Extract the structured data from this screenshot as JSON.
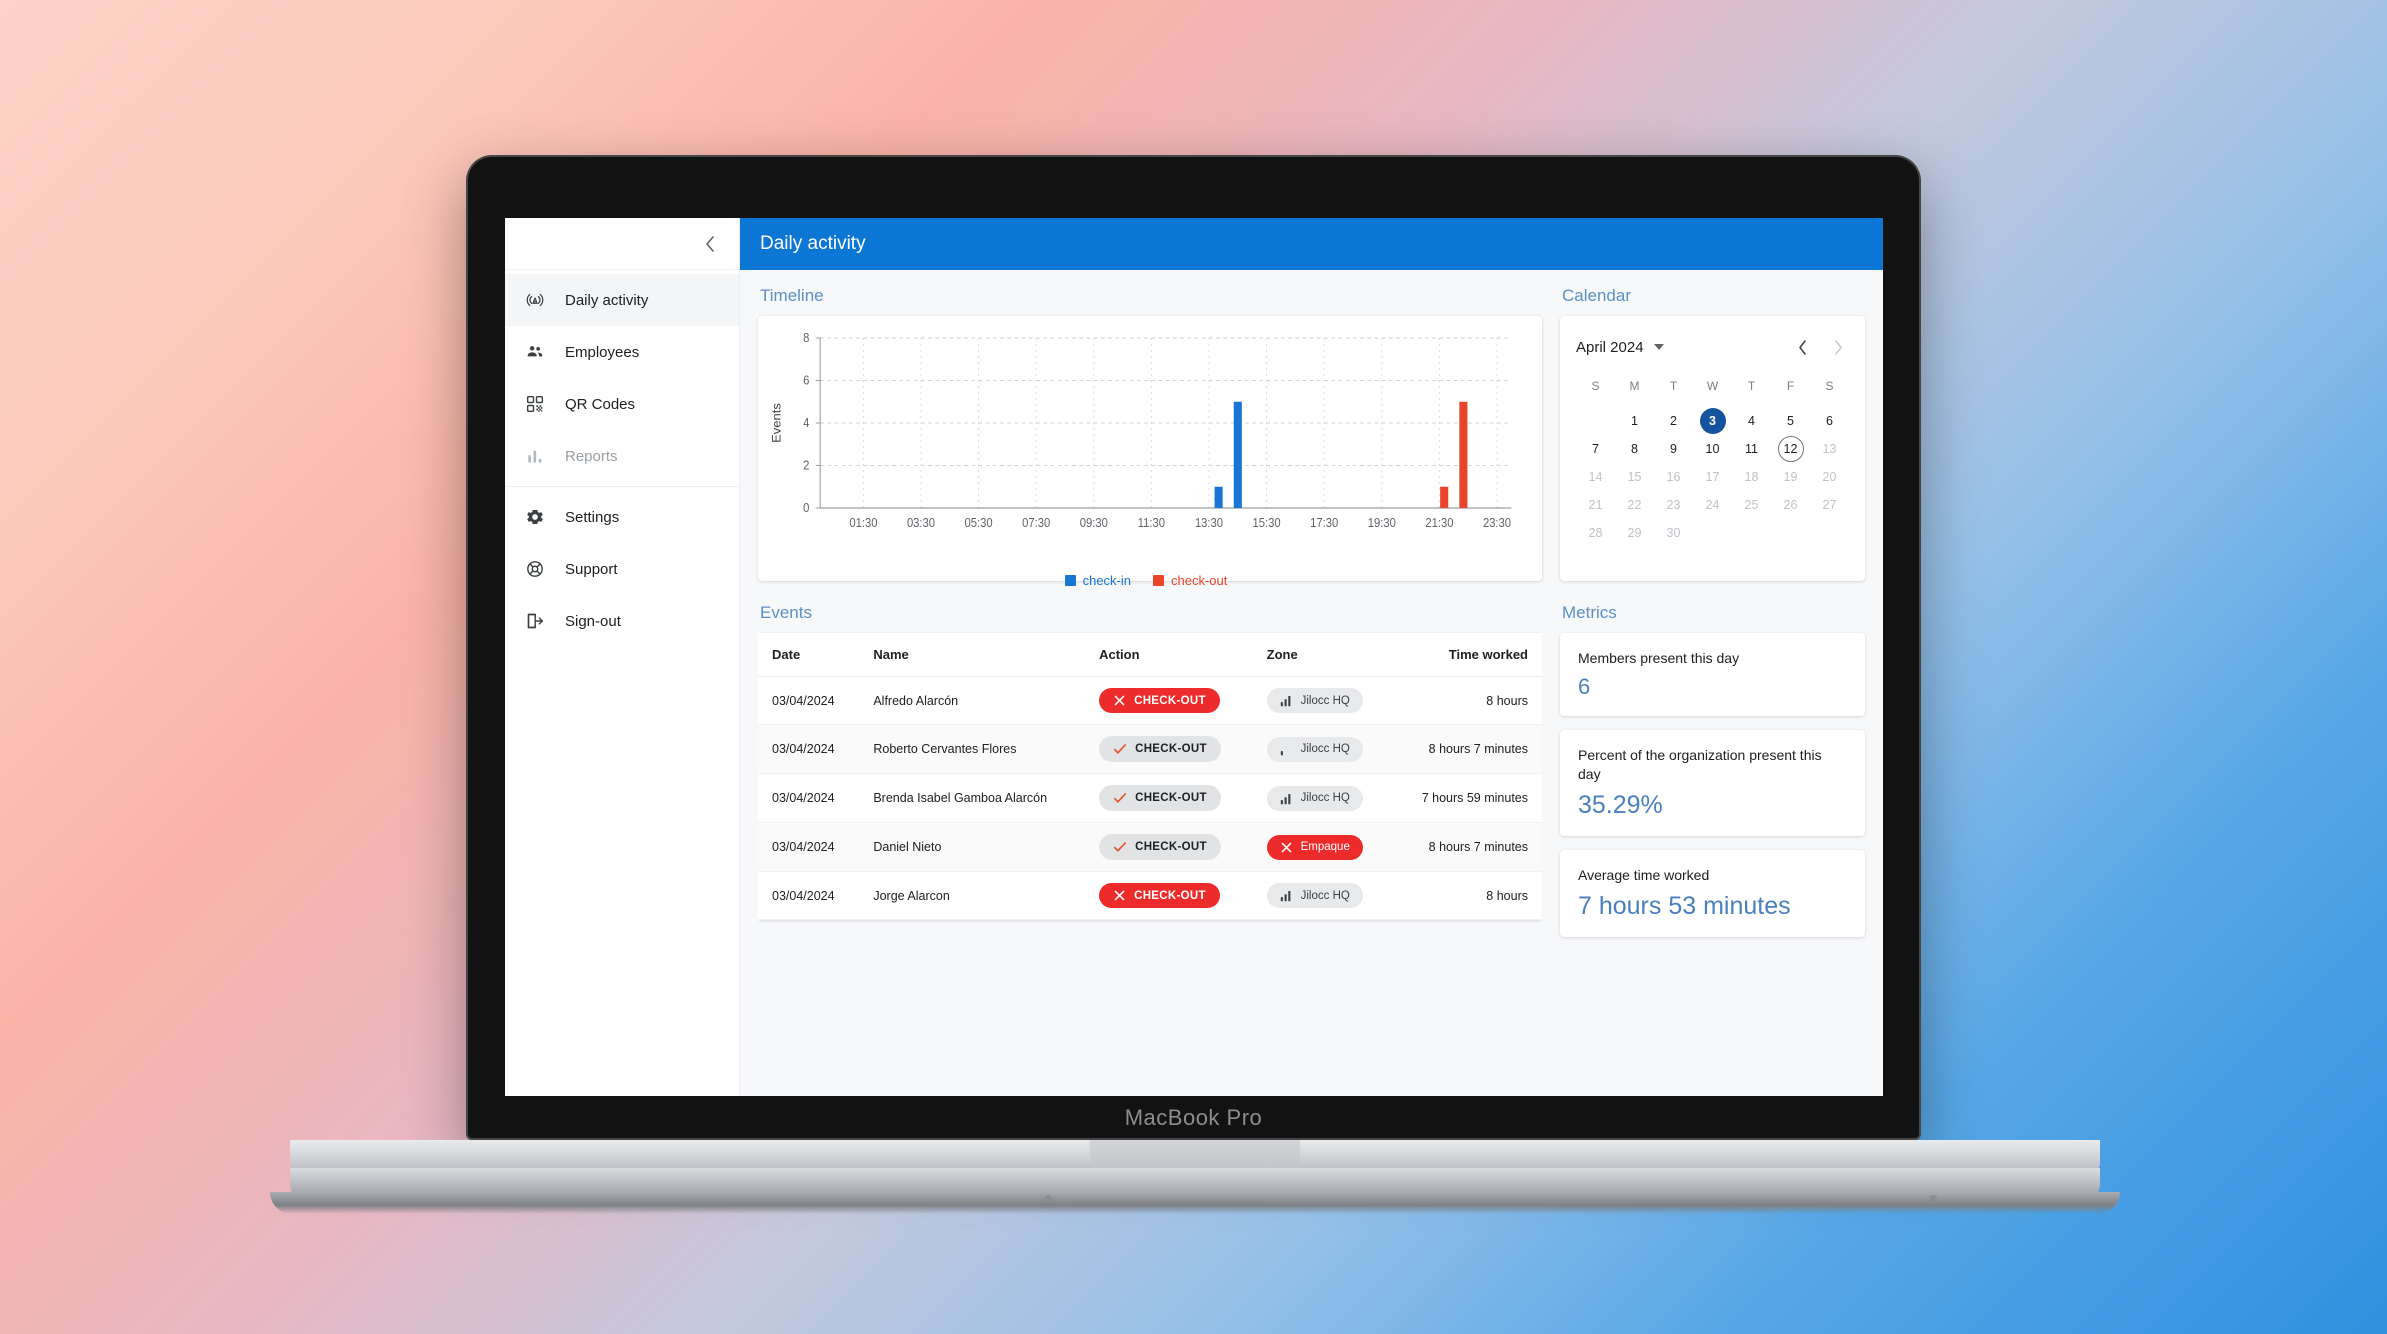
{
  "device": {
    "brand_label": "MacBook Pro"
  },
  "topbar": {
    "title": "Daily activity"
  },
  "sidebar": {
    "collapse_icon": "chevron-left-icon",
    "items": [
      {
        "label": "Daily activity",
        "icon": "broadcast-icon",
        "active": true,
        "disabled": false
      },
      {
        "label": "Employees",
        "icon": "people-icon",
        "active": false,
        "disabled": false
      },
      {
        "label": "QR Codes",
        "icon": "qr-code-icon",
        "active": false,
        "disabled": false
      },
      {
        "label": "Reports",
        "icon": "bar-chart-icon",
        "active": false,
        "disabled": true
      },
      {
        "label": "Settings",
        "icon": "gear-icon",
        "active": false,
        "disabled": false
      },
      {
        "label": "Support",
        "icon": "lifebuoy-icon",
        "active": false,
        "disabled": false
      },
      {
        "label": "Sign-out",
        "icon": "sign-out-icon",
        "active": false,
        "disabled": false
      }
    ]
  },
  "timeline": {
    "title": "Timeline"
  },
  "chart_data": {
    "type": "bar",
    "title": "Timeline",
    "xlabel": "",
    "ylabel": "Events",
    "ylim": [
      0,
      8
    ],
    "yticks": [
      0,
      2,
      4,
      6,
      8
    ],
    "xlim": [
      "00:00",
      "24:00"
    ],
    "xticks": [
      "01:30",
      "03:30",
      "05:30",
      "07:30",
      "09:30",
      "11:30",
      "13:30",
      "15:30",
      "17:30",
      "19:30",
      "21:30",
      "23:30"
    ],
    "grid": true,
    "legend_position": "bottom",
    "series": [
      {
        "name": "check-in",
        "color": "#1976d2",
        "points": [
          {
            "x": "13:50",
            "y": 1
          },
          {
            "x": "14:30",
            "y": 5
          }
        ]
      },
      {
        "name": "check-out",
        "color": "#e8452c",
        "points": [
          {
            "x": "21:40",
            "y": 1
          },
          {
            "x": "22:20",
            "y": 5
          }
        ]
      }
    ]
  },
  "calendar": {
    "title": "Calendar",
    "month_label": "April 2024",
    "prev_label": "‹",
    "next_label": "›",
    "dow": [
      "S",
      "M",
      "T",
      "W",
      "T",
      "F",
      "S"
    ],
    "lead_blank": 1,
    "days": [
      {
        "n": "1",
        "state": "normal"
      },
      {
        "n": "2",
        "state": "normal"
      },
      {
        "n": "3",
        "state": "selected"
      },
      {
        "n": "4",
        "state": "normal"
      },
      {
        "n": "5",
        "state": "normal"
      },
      {
        "n": "6",
        "state": "normal"
      },
      {
        "n": "7",
        "state": "normal"
      },
      {
        "n": "8",
        "state": "normal"
      },
      {
        "n": "9",
        "state": "normal"
      },
      {
        "n": "10",
        "state": "normal"
      },
      {
        "n": "11",
        "state": "normal"
      },
      {
        "n": "12",
        "state": "today"
      },
      {
        "n": "13",
        "state": "muted"
      },
      {
        "n": "14",
        "state": "muted"
      },
      {
        "n": "15",
        "state": "muted"
      },
      {
        "n": "16",
        "state": "muted"
      },
      {
        "n": "17",
        "state": "muted"
      },
      {
        "n": "18",
        "state": "muted"
      },
      {
        "n": "19",
        "state": "muted"
      },
      {
        "n": "20",
        "state": "muted"
      },
      {
        "n": "21",
        "state": "muted"
      },
      {
        "n": "22",
        "state": "muted"
      },
      {
        "n": "23",
        "state": "muted"
      },
      {
        "n": "24",
        "state": "muted"
      },
      {
        "n": "25",
        "state": "muted"
      },
      {
        "n": "26",
        "state": "muted"
      },
      {
        "n": "27",
        "state": "muted"
      },
      {
        "n": "28",
        "state": "muted"
      },
      {
        "n": "29",
        "state": "muted"
      },
      {
        "n": "30",
        "state": "muted"
      }
    ]
  },
  "events": {
    "title": "Events",
    "columns": [
      "Date",
      "Name",
      "Action",
      "Zone",
      "Time worked"
    ],
    "rows": [
      {
        "date": "03/04/2024",
        "name": "Alfredo Alarcón",
        "action": "CHECK-OUT",
        "action_style": "red",
        "action_icon": "x-icon",
        "zone": "Jilocc HQ",
        "zone_style": "grey",
        "zone_icon": "signal-strong-icon",
        "time_worked": "8 hours"
      },
      {
        "date": "03/04/2024",
        "name": "Roberto Cervantes Flores",
        "action": "CHECK-OUT",
        "action_style": "grey",
        "action_icon": "check-icon",
        "zone": "Jilocc HQ",
        "zone_style": "grey",
        "zone_icon": "signal-weak-icon",
        "time_worked": "8 hours 7 minutes"
      },
      {
        "date": "03/04/2024",
        "name": "Brenda Isabel Gamboa Alarcón",
        "action": "CHECK-OUT",
        "action_style": "grey",
        "action_icon": "check-icon",
        "zone": "Jilocc HQ",
        "zone_style": "grey",
        "zone_icon": "signal-strong-icon",
        "time_worked": "7 hours 59 minutes"
      },
      {
        "date": "03/04/2024",
        "name": "Daniel Nieto",
        "action": "CHECK-OUT",
        "action_style": "grey",
        "action_icon": "check-icon",
        "zone": "Empaque",
        "zone_style": "red",
        "zone_icon": "x-icon",
        "time_worked": "8 hours 7 minutes"
      },
      {
        "date": "03/04/2024",
        "name": "Jorge Alarcon",
        "action": "CHECK-OUT",
        "action_style": "red",
        "action_icon": "x-icon",
        "zone": "Jilocc HQ",
        "zone_style": "grey",
        "zone_icon": "signal-strong-icon",
        "time_worked": "8 hours"
      }
    ]
  },
  "metrics": {
    "title": "Metrics",
    "cards": [
      {
        "label": "Members present this day",
        "value": "6",
        "big": false
      },
      {
        "label": "Percent of the organization present this day",
        "value": "35.29%",
        "big": true
      },
      {
        "label": "Average time worked",
        "value": "7 hours 53 minutes",
        "big": true
      }
    ]
  },
  "colors": {
    "accent_blue": "#0b76d4",
    "section_title": "#5b90c6",
    "metric_value": "#4a80bd",
    "check_in": "#1976d2",
    "check_out": "#e8452c",
    "badge_red": "#ee2b2b",
    "calendar_selected": "#16539e"
  }
}
